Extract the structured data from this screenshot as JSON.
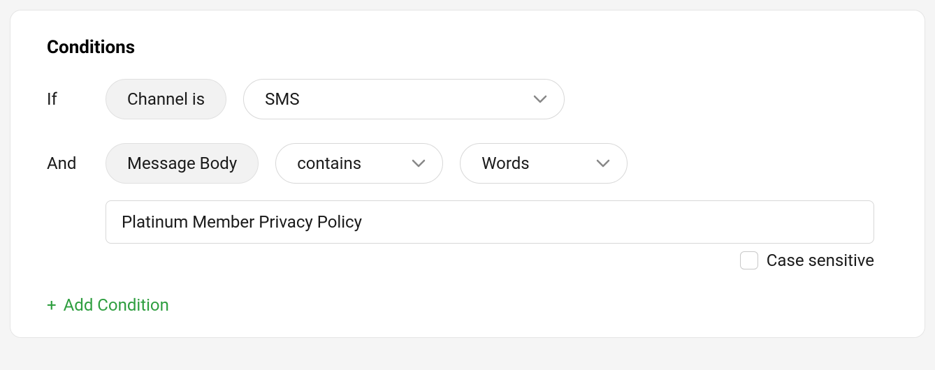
{
  "section": {
    "title": "Conditions"
  },
  "row1": {
    "prefix": "If",
    "field": "Channel is",
    "value": "SMS"
  },
  "row2": {
    "prefix": "And",
    "field": "Message Body",
    "operator": "contains",
    "match_type": "Words"
  },
  "input": {
    "value": "Platinum Member Privacy Policy"
  },
  "case_sensitive": {
    "label": "Case sensitive",
    "checked": false
  },
  "add_condition": {
    "label": "Add Condition"
  }
}
